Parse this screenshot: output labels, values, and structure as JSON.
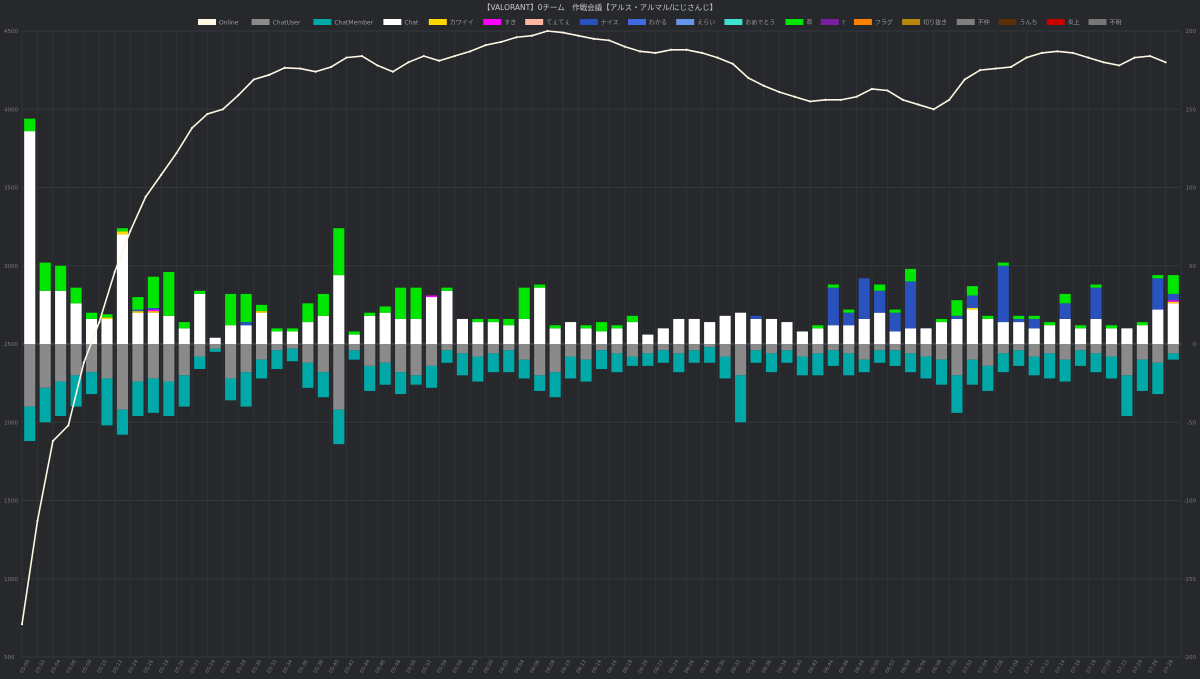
{
  "chart_data": {
    "type": "bar",
    "title": "【VALORANT】0チーム　作戦会議【アルス・アルマル/にじさんじ】",
    "legend_position": "top",
    "grid": true,
    "y_left": {
      "ticks": [
        500,
        1000,
        1500,
        2000,
        2500,
        3000,
        3500,
        4000,
        4500
      ],
      "ylim": [
        500,
        4500
      ]
    },
    "y_right": {
      "ticks": [
        -200,
        -150,
        -100,
        -50,
        0,
        50,
        100,
        150,
        200
      ],
      "ylim": [
        -200,
        200
      ]
    },
    "x_labels": [
      "05:00",
      "05:02",
      "05:04",
      "05:06",
      "05:08",
      "05:10",
      "05:12",
      "05:14",
      "05:16",
      "05:18",
      "05:20",
      "05:22",
      "05:24",
      "05:26",
      "05:28",
      "05:30",
      "05:32",
      "05:34",
      "05:36",
      "05:38",
      "05:40",
      "05:42",
      "05:44",
      "05:46",
      "05:48",
      "05:50",
      "05:52",
      "05:54",
      "05:56",
      "05:58",
      "06:00",
      "06:02",
      "06:04",
      "06:06",
      "06:08",
      "06:10",
      "06:12",
      "06:14",
      "06:16",
      "06:18",
      "06:20",
      "06:22",
      "06:24",
      "06:26",
      "06:28",
      "06:30",
      "06:32",
      "06:34",
      "06:36",
      "06:38",
      "06:40",
      "06:42",
      "06:44",
      "06:46",
      "06:48",
      "06:50",
      "06:52",
      "06:54",
      "06:56",
      "06:58",
      "07:00",
      "07:02",
      "07:04",
      "07:06",
      "07:08",
      "07:10",
      "07:12",
      "07:14",
      "07:16",
      "07:18",
      "07:20",
      "07:22",
      "07:24",
      "07:26",
      "07:28"
    ],
    "legend": [
      {
        "name": "Online",
        "color": "#fdf6e3"
      },
      {
        "name": "ChatUser",
        "color": "#8a8a8a"
      },
      {
        "name": "ChatMember",
        "color": "#00a8a8"
      },
      {
        "name": "Chat",
        "color": "#ffffff"
      },
      {
        "name": "カワイイ",
        "color": "#ffd700"
      },
      {
        "name": "すき",
        "color": "#ff00ff"
      },
      {
        "name": "てぇてぇ",
        "color": "#ffb6a0"
      },
      {
        "name": "ナイス",
        "color": "#2a52be"
      },
      {
        "name": "わかる",
        "color": "#4169e1"
      },
      {
        "name": "えらい",
        "color": "#6495ed"
      },
      {
        "name": "おめでとう",
        "color": "#40e0d0"
      },
      {
        "name": "草",
        "color": "#00e600"
      },
      {
        "name": "?",
        "color": "#7b1fa2"
      },
      {
        "name": "フラグ",
        "color": "#ff8000"
      },
      {
        "name": "切り抜き",
        "color": "#b8860b"
      },
      {
        "name": "不仲",
        "color": "#808080"
      },
      {
        "name": "うんち",
        "color": "#5c2e0a"
      },
      {
        "name": "炎上",
        "color": "#cc0000"
      },
      {
        "name": "不明",
        "color": "#777777"
      }
    ],
    "series": [
      {
        "name": "Online",
        "type": "line",
        "axis": "left",
        "color": "#fdf6e3",
        "values": [
          710,
          1370,
          1880,
          1980,
          2380,
          2640,
          2960,
          3220,
          3440,
          3580,
          3720,
          3880,
          3970,
          4000,
          4090,
          4190,
          4220,
          4265,
          4260,
          4240,
          4270,
          4330,
          4340,
          4280,
          4240,
          4300,
          4340,
          4310,
          4340,
          4370,
          4410,
          4430,
          4460,
          4470,
          4500,
          4490,
          4470,
          4450,
          4440,
          4400,
          4370,
          4360,
          4380,
          4380,
          4360,
          4330,
          4290,
          4200,
          4150,
          4110,
          4080,
          4050,
          4060,
          4060,
          4080,
          4130,
          4120,
          4060,
          4030,
          4000,
          4060,
          4190,
          4250,
          4260,
          4270,
          4330,
          4360,
          4370,
          4360,
          4330,
          4300,
          4280,
          4330,
          4340,
          4300
        ]
      },
      {
        "name": "ChatUser",
        "axis": "right",
        "stack": "neg",
        "color": "#8a8a8a",
        "values": [
          -40,
          -28,
          -24,
          -20,
          -18,
          -22,
          -42,
          -24,
          -22,
          -24,
          -20,
          -8,
          -3,
          -22,
          -18,
          -10,
          -4,
          -3,
          -12,
          -18,
          -42,
          -4,
          -14,
          -12,
          -18,
          -20,
          -14,
          -4,
          -6,
          -8,
          -6,
          -4,
          -10,
          -20,
          -18,
          -8,
          -10,
          -4,
          -6,
          -8,
          -6,
          -4,
          -6,
          -4,
          -2,
          -8,
          -20,
          -4,
          -6,
          -4,
          -8,
          -6,
          -4,
          -6,
          -10,
          -4,
          -4,
          -6,
          -8,
          -10,
          -20,
          -10,
          -14,
          -6,
          -4,
          -8,
          -6,
          -10,
          -4,
          -6,
          -8,
          -20,
          -10,
          -12,
          -6
        ]
      },
      {
        "name": "ChatMember",
        "axis": "right",
        "stack": "neg",
        "color": "#00a8a8",
        "values": [
          -22,
          -22,
          -22,
          -20,
          -14,
          -30,
          -16,
          -22,
          -22,
          -22,
          -20,
          -8,
          -2,
          -14,
          -22,
          -12,
          -12,
          -8,
          -16,
          -16,
          -22,
          -6,
          -16,
          -14,
          -14,
          -6,
          -14,
          -8,
          -14,
          -16,
          -12,
          -14,
          -12,
          -10,
          -16,
          -14,
          -14,
          -12,
          -12,
          -6,
          -8,
          -8,
          -12,
          -8,
          -10,
          -14,
          -30,
          -8,
          -12,
          -8,
          -12,
          -14,
          -10,
          -14,
          -8,
          -8,
          -10,
          -12,
          -14,
          -16,
          -24,
          -16,
          -16,
          -12,
          -10,
          -12,
          -16,
          -14,
          -10,
          -12,
          -14,
          -26,
          -20,
          -20,
          -4
        ]
      },
      {
        "name": "Chat",
        "axis": "right",
        "stack": "pos",
        "color": "#ffffff",
        "values": [
          136,
          34,
          34,
          26,
          16,
          16,
          70,
          20,
          20,
          18,
          10,
          32,
          4,
          12,
          12,
          20,
          8,
          8,
          14,
          18,
          44,
          6,
          18,
          20,
          16,
          16,
          30,
          34,
          16,
          14,
          14,
          12,
          16,
          36,
          10,
          14,
          10,
          8,
          10,
          14,
          6,
          10,
          16,
          16,
          14,
          18,
          20,
          16,
          16,
          14,
          8,
          10,
          12,
          12,
          16,
          20,
          8,
          10,
          10,
          14,
          16,
          22,
          16,
          14,
          14,
          10,
          12,
          16,
          10,
          16,
          10,
          10,
          12,
          22,
          26
        ]
      },
      {
        "name": "カワイイ",
        "axis": "right",
        "stack": "pos",
        "color": "#ffd700",
        "values": [
          0,
          0,
          0,
          0,
          0,
          1,
          2,
          1,
          1,
          0,
          0,
          0,
          0,
          0,
          0,
          1,
          0,
          0,
          0,
          0,
          0,
          0,
          0,
          0,
          0,
          0,
          0,
          0,
          0,
          0,
          0,
          0,
          0,
          0,
          0,
          0,
          0,
          0,
          0,
          0,
          0,
          0,
          0,
          0,
          0,
          0,
          0,
          0,
          0,
          0,
          0,
          0,
          0,
          0,
          0,
          0,
          0,
          0,
          0,
          0,
          0,
          1,
          0,
          0,
          0,
          0,
          0,
          0,
          0,
          0,
          0,
          0,
          0,
          0,
          1
        ]
      },
      {
        "name": "すき",
        "axis": "right",
        "stack": "pos",
        "color": "#ff00ff",
        "values": [
          0,
          0,
          0,
          0,
          0,
          0,
          0,
          0,
          1,
          0,
          0,
          0,
          0,
          0,
          0,
          0,
          0,
          0,
          0,
          0,
          0,
          0,
          0,
          0,
          0,
          0,
          1,
          0,
          0,
          0,
          0,
          0,
          0,
          0,
          0,
          0,
          0,
          0,
          0,
          0,
          0,
          0,
          0,
          0,
          0,
          0,
          0,
          0,
          0,
          0,
          0,
          0,
          0,
          0,
          0,
          0,
          0,
          0,
          0,
          0,
          0,
          0,
          0,
          0,
          0,
          0,
          0,
          0,
          0,
          0,
          0,
          0,
          0,
          0,
          1
        ]
      },
      {
        "name": "ナイス",
        "axis": "right",
        "stack": "pos",
        "color": "#2a52be",
        "values": [
          0,
          0,
          0,
          0,
          0,
          0,
          0,
          1,
          1,
          0,
          0,
          0,
          0,
          0,
          2,
          0,
          0,
          0,
          0,
          0,
          0,
          0,
          0,
          0,
          0,
          0,
          0,
          0,
          0,
          0,
          0,
          0,
          0,
          0,
          0,
          0,
          0,
          0,
          0,
          0,
          0,
          0,
          0,
          0,
          0,
          0,
          0,
          2,
          0,
          0,
          0,
          0,
          24,
          8,
          26,
          14,
          12,
          30,
          0,
          0,
          2,
          8,
          0,
          36,
          2,
          6,
          0,
          10,
          0,
          20,
          0,
          0,
          0,
          20,
          4
        ]
      },
      {
        "name": "草",
        "axis": "right",
        "stack": "pos",
        "color": "#00e600",
        "values": [
          8,
          18,
          16,
          10,
          4,
          2,
          2,
          8,
          20,
          28,
          4,
          2,
          0,
          20,
          18,
          4,
          2,
          2,
          12,
          14,
          30,
          2,
          2,
          4,
          20,
          20,
          0,
          2,
          0,
          2,
          2,
          4,
          20,
          2,
          2,
          0,
          2,
          6,
          2,
          4,
          0,
          0,
          0,
          0,
          0,
          0,
          0,
          0,
          0,
          0,
          0,
          2,
          2,
          2,
          0,
          4,
          2,
          8,
          0,
          2,
          10,
          6,
          2,
          2,
          2,
          2,
          2,
          6,
          2,
          2,
          2,
          0,
          2,
          2,
          12
        ]
      }
    ]
  }
}
